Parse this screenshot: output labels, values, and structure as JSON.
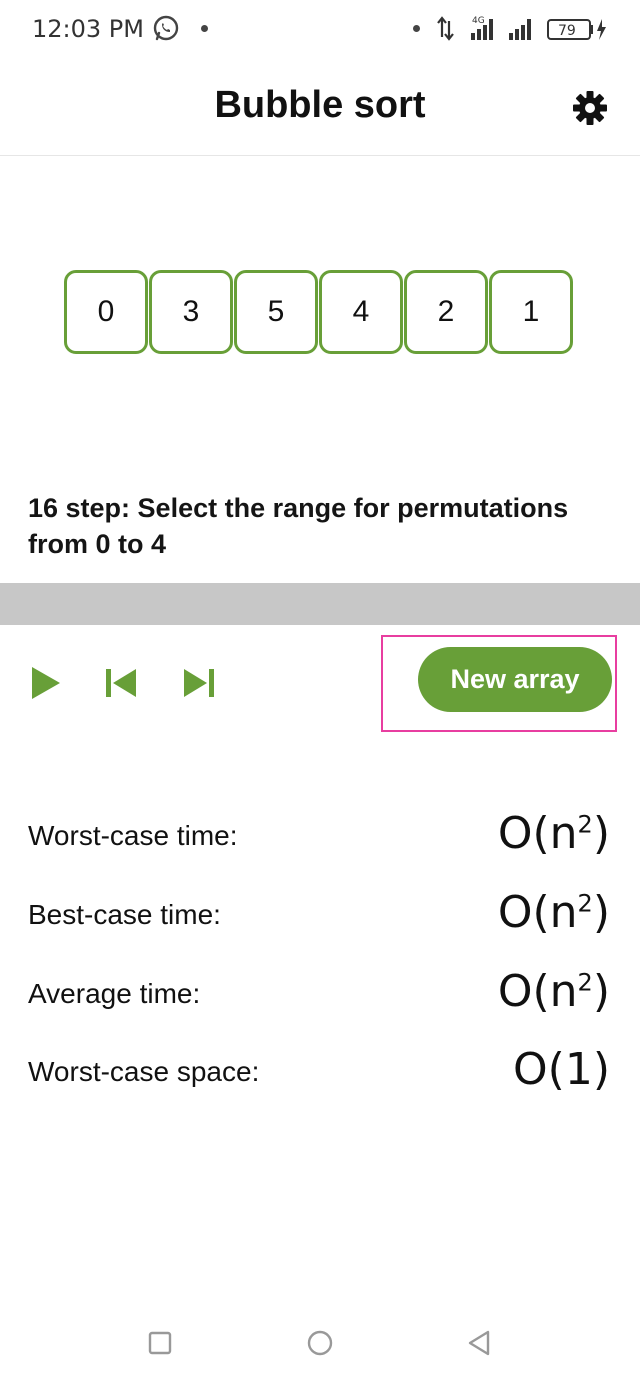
{
  "status_bar": {
    "time": "12:03 PM",
    "network": "4G",
    "battery": "79",
    "icons": [
      "whatsapp-icon",
      "data-arrows-icon",
      "signal-4g-icon",
      "signal-icon",
      "battery-icon",
      "charging-icon"
    ]
  },
  "app_bar": {
    "title": "Bubble sort",
    "settings_icon": "gear-icon"
  },
  "array": {
    "values": [
      "0",
      "3",
      "5",
      "4",
      "2",
      "1"
    ],
    "cell_border_color": "#689f38"
  },
  "step": {
    "text": "16 step: Select the range for permutations from 0 to 4"
  },
  "controls": {
    "play_icon": "play-icon",
    "prev_icon": "skip-previous-icon",
    "next_icon": "skip-next-icon",
    "new_array_label": "New array",
    "accent_color": "#689f38"
  },
  "complexity": [
    {
      "label": "Worst-case time:",
      "value": "O(n",
      "sup": "2",
      "tail": ")"
    },
    {
      "label": "Best-case time:",
      "value": "O(n",
      "sup": "2",
      "tail": ")"
    },
    {
      "label": "Average time:",
      "value": "O(n",
      "sup": "2",
      "tail": ")"
    },
    {
      "label": "Worst-case space:",
      "value": "O(1)",
      "sup": "",
      "tail": ""
    }
  ],
  "nav_bar": {
    "icons": [
      "recents-square-icon",
      "home-circle-icon",
      "back-triangle-icon"
    ]
  }
}
